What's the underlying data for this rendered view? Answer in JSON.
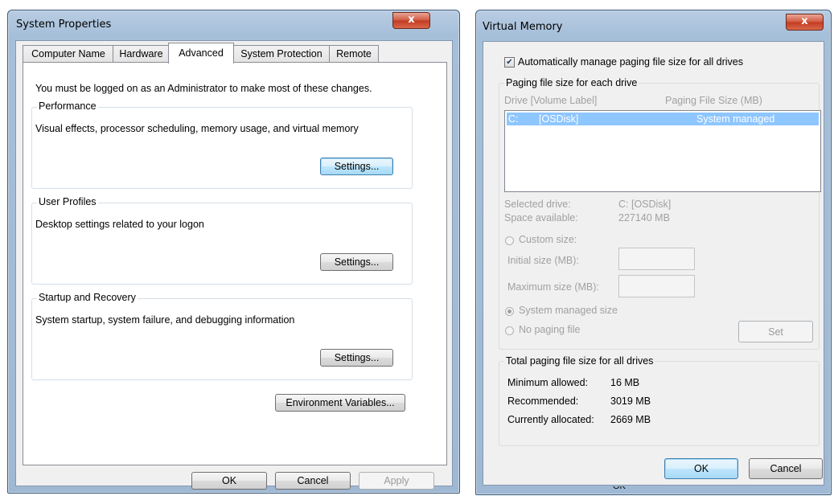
{
  "system_properties": {
    "title": "System Properties",
    "close_label": "x",
    "tabs": [
      "Computer Name",
      "Hardware",
      "Advanced",
      "System Protection",
      "Remote"
    ],
    "admin_note": "You must be logged on as an Administrator to make most of these changes.",
    "performance": {
      "title": "Performance",
      "description": "Visual effects, processor scheduling, memory usage, and virtual memory",
      "button": "Settings..."
    },
    "user_profiles": {
      "title": "User Profiles",
      "description": "Desktop settings related to your logon",
      "button": "Settings..."
    },
    "startup_recovery": {
      "title": "Startup and Recovery",
      "description": "System startup, system failure, and debugging information",
      "button": "Settings..."
    },
    "env_button": "Environment Variables...",
    "ok": "OK",
    "cancel": "Cancel",
    "apply": "Apply"
  },
  "virtual_memory": {
    "title": "Virtual Memory",
    "close_label": "x",
    "auto_manage": {
      "label": "Automatically manage paging file size for all drives",
      "checked": true
    },
    "paging_group": {
      "title": "Paging file size for each drive",
      "col_drive": "Drive  [Volume Label]",
      "col_size": "Paging File Size (MB)",
      "row": {
        "drive": "C:",
        "label": "[OSDisk]",
        "size": "System managed"
      },
      "selected_drive_label": "Selected drive:",
      "selected_drive_value": "C:  [OSDisk]",
      "space_available_label": "Space available:",
      "space_available_value": "227140 MB",
      "custom_size": "Custom size:",
      "initial_size": "Initial size (MB):",
      "maximum_size": "Maximum size (MB):",
      "system_managed": "System managed size",
      "no_paging": "No paging file",
      "set_button": "Set"
    },
    "totals": {
      "title": "Total paging file size for all drives",
      "min_label": "Minimum allowed:",
      "min_value": "16 MB",
      "rec_label": "Recommended:",
      "rec_value": "3019 MB",
      "cur_label": "Currently allocated:",
      "cur_value": "2669 MB"
    },
    "ok": "OK",
    "cancel": "Cancel",
    "back_ok": "OK"
  }
}
